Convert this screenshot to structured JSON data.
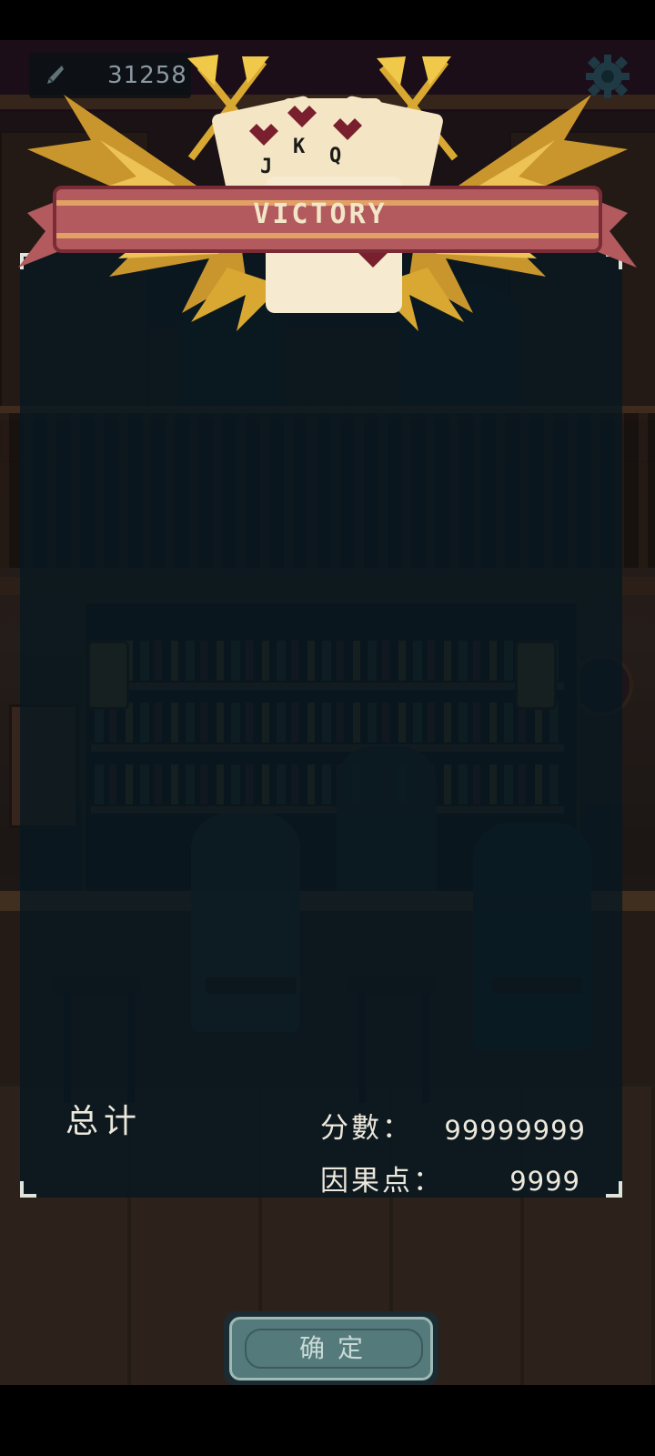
{
  "currency": {
    "value": "31258",
    "icon": "feather-quill-icon"
  },
  "header": {
    "settings_icon": "gear-icon"
  },
  "emblem": {
    "banner_text": "VICTORY",
    "cards": [
      "J",
      "K",
      "Q"
    ],
    "icons": [
      "crossed-axes-icon",
      "golden-wings-icon",
      "playing-cards-icon"
    ]
  },
  "results": {
    "title": "总计",
    "score_label": "分數：",
    "score_value": "99999999",
    "karma_label": "因果点：",
    "karma_value": "9999"
  },
  "confirm": {
    "label": "确定"
  },
  "colors": {
    "gold": "#e0b33a",
    "banner": "#b35a5e",
    "card": "#f4e6c4",
    "heart": "#7a1f2e",
    "panel": "#081820",
    "button": "#557a7c",
    "text": "#ece8dc"
  }
}
